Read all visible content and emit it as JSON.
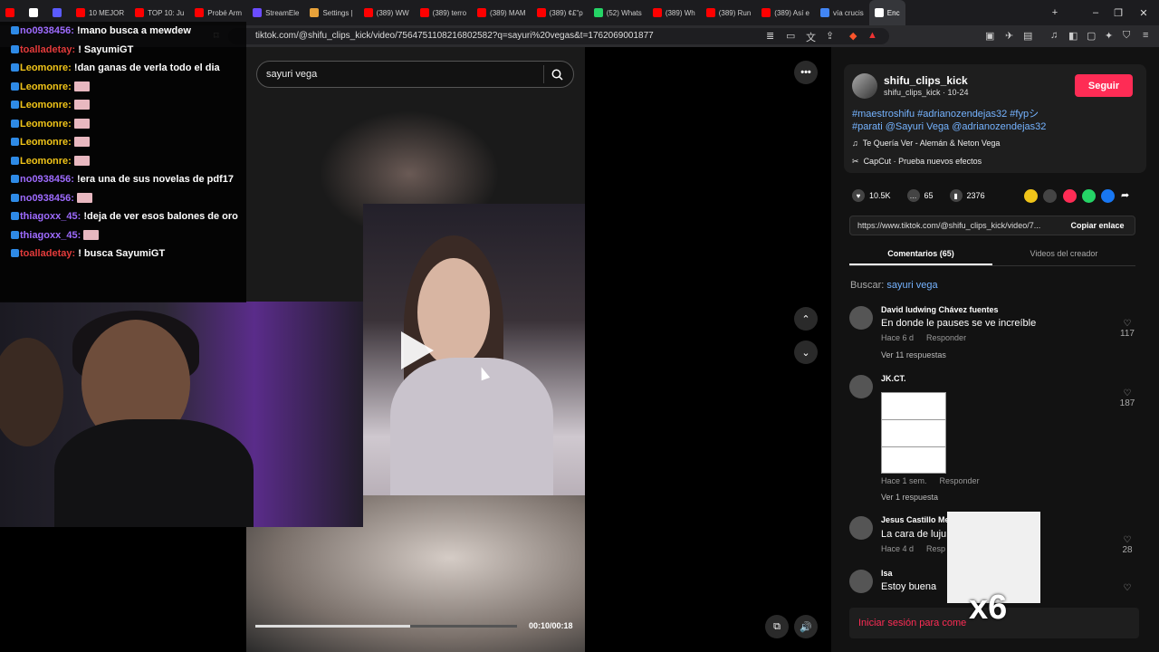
{
  "tabs": [
    {
      "label": "",
      "color": "#ff0000"
    },
    {
      "label": "",
      "color": "#ffffff"
    },
    {
      "label": "",
      "color": "#5b5bff"
    },
    {
      "label": "10 MEJOR",
      "color": "#ff0000"
    },
    {
      "label": "TOP 10: Ju",
      "color": "#ff0000"
    },
    {
      "label": "Probé Arm",
      "color": "#ff0000"
    },
    {
      "label": "StreamEle",
      "color": "#6b4cff"
    },
    {
      "label": "Settings |",
      "color": "#e8a23a"
    },
    {
      "label": "(389) WW",
      "color": "#ff0000"
    },
    {
      "label": "(389) terro",
      "color": "#ff0000"
    },
    {
      "label": "(389) MAM",
      "color": "#ff0000"
    },
    {
      "label": "(389) ¢£\"p",
      "color": "#ff0000"
    },
    {
      "label": "(52) Whats",
      "color": "#25d366"
    },
    {
      "label": "(389) Wh",
      "color": "#ff0000"
    },
    {
      "label": "(389) Run",
      "color": "#ff0000"
    },
    {
      "label": "(389) Así e",
      "color": "#ff0000"
    },
    {
      "label": "vía crucis",
      "color": "#4285f4"
    },
    {
      "label": "Enc",
      "color": "#ffffff"
    }
  ],
  "address": {
    "url": "tiktok.com/@shifu_clips_kick/video/7564751108216802582?q=sayuri%20vegas&t=1762069001877"
  },
  "chat": [
    {
      "user": "no0938456:",
      "msg": "!mano busca a mewdew",
      "color": "purple"
    },
    {
      "user": "toalladetay:",
      "msg": "! SayumiGT",
      "color": "red"
    },
    {
      "user": "Leomonre:",
      "msg": "!dan ganas de verla todo el dia",
      "color": "yel"
    },
    {
      "user": "Leomonre:",
      "msg": "",
      "color": "yel",
      "emote": true
    },
    {
      "user": "Leomonre:",
      "msg": "",
      "color": "yel",
      "emote": true
    },
    {
      "user": "Leomonre:",
      "msg": "",
      "color": "yel",
      "emote": true
    },
    {
      "user": "Leomonre:",
      "msg": "",
      "color": "yel",
      "emote": true
    },
    {
      "user": "Leomonre:",
      "msg": "",
      "color": "yel",
      "emote": true
    },
    {
      "user": "no0938456:",
      "msg": "!era una de sus novelas de pdf17",
      "color": "purple"
    },
    {
      "user": "no0938456:",
      "msg": "",
      "color": "purple",
      "emote": true
    },
    {
      "user": "thiagoxx_45:",
      "msg": "!deja de ver esos balones de oro",
      "color": "purple"
    },
    {
      "user": "thiagoxx_45:",
      "msg": "",
      "color": "purple",
      "emote": true
    },
    {
      "user": "toalladetay:",
      "msg": "! busca SayumiGT",
      "color": "red"
    }
  ],
  "search": {
    "value": "sayuri vega"
  },
  "video": {
    "time": "00:10/00:18",
    "progress": 0.59
  },
  "post": {
    "username": "shifu_clips_kick",
    "subline": "shifu_clips_kick · 10-24",
    "follow": "Seguir",
    "hashtags": "#maestroshifu #adrianozendejas32 #fypシ #parati @Sayuri Vega @adrianozendejas32",
    "music": "Te Quería Ver - Alemán & Neton Vega",
    "effect": "CapCut · Prueba nuevos efectos",
    "likes": "10.5K",
    "comments": "65",
    "saves": "2376",
    "link": "https://www.tiktok.com/@shifu_clips_kick/video/7...",
    "copy": "Copiar enlace"
  },
  "tabs_panel": {
    "comments": "Comentarios (65)",
    "videos": "Videos del creador"
  },
  "buscar": {
    "label": "Buscar: ",
    "term": "sayuri vega"
  },
  "comments": [
    {
      "name": "David ludwing Chávez fuentes",
      "text": "En donde le pauses se ve increíble",
      "meta": "Hace 6 d",
      "reply": "Responder",
      "likes": "117",
      "more": "Ver 11 respuestas"
    },
    {
      "name": "JK.CT.",
      "text": "",
      "meta": "Hace 1 sem.",
      "reply": "Responder",
      "likes": "187",
      "more": "Ver 1 respuesta"
    },
    {
      "name": "Jesus Castillo Me",
      "text": "La cara de luju",
      "meta": "Hace 4 d",
      "reply": "Resp",
      "likes": "28",
      "more": ""
    },
    {
      "name": "Isa",
      "text": "Estoy buena",
      "meta": "",
      "reply": "",
      "likes": "",
      "more": ""
    }
  ],
  "login": "Iniciar sesión para come",
  "overlay": {
    "count": "x6"
  }
}
